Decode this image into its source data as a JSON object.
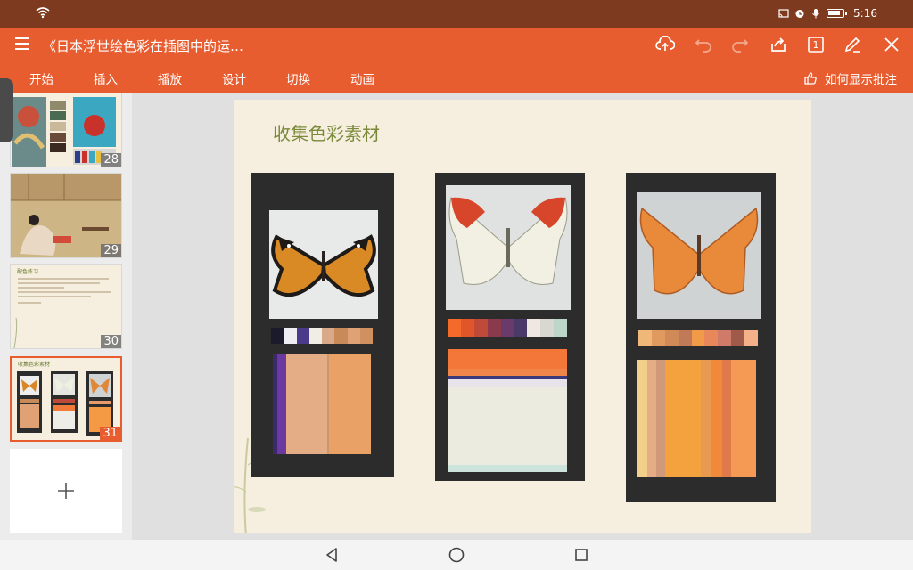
{
  "status_bar": {
    "time": "5:16",
    "icons": [
      "wifi-icon",
      "cast-icon",
      "alarm-icon",
      "mic-icon",
      "battery-icon"
    ]
  },
  "app_bar": {
    "document_title": "《日本浮世绘色彩在插图中的运…",
    "page_indicator": "1",
    "icons": [
      "menu-icon",
      "cloud-upload-icon",
      "undo-icon",
      "redo-icon",
      "share-icon",
      "page-view-icon",
      "edit-icon",
      "close-icon"
    ]
  },
  "ribbon": {
    "tabs": [
      "开始",
      "插入",
      "播放",
      "设计",
      "切换",
      "动画"
    ],
    "comment_link": "如何显示批注"
  },
  "slides_panel": {
    "thumbnails": [
      {
        "number": "28"
      },
      {
        "number": "29"
      },
      {
        "number": "30",
        "title": "配色练习"
      },
      {
        "number": "31",
        "title": "收集色彩素材"
      }
    ],
    "selected": "31"
  },
  "slide": {
    "title": "收集色彩素材"
  },
  "colors": {
    "accent": "#e85d2f",
    "status_bar": "#7e3a1f",
    "slide_title": "#7a8a3a",
    "slide_bg": "#f6efdf"
  }
}
